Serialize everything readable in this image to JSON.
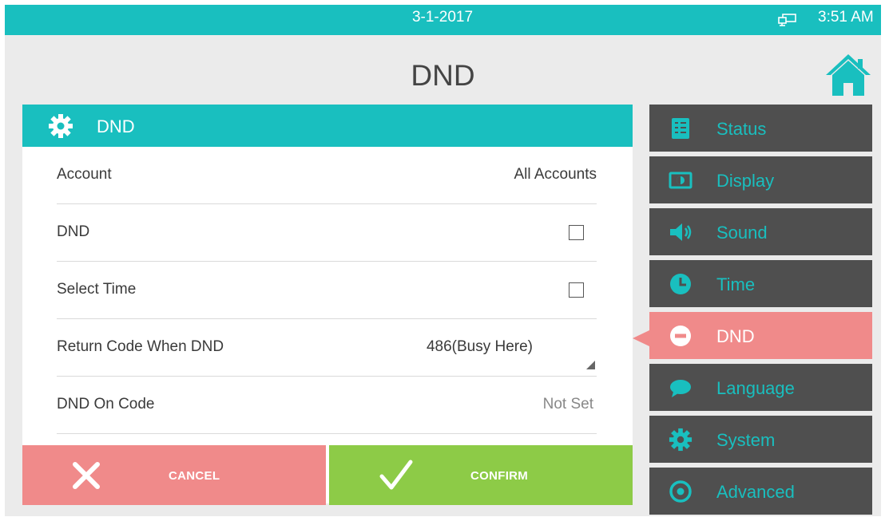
{
  "statusbar": {
    "date": "3-1-2017",
    "time": "3:51 AM",
    "network_icon": "network-icon"
  },
  "page": {
    "title": "DND",
    "home_icon": "home-icon"
  },
  "panel": {
    "header_label": "DND",
    "header_icon": "gear-icon",
    "rows": [
      {
        "label": "Account",
        "value": "All Accounts"
      },
      {
        "label": "DND",
        "checked": false
      },
      {
        "label": "Select Time",
        "checked": false
      },
      {
        "label": "Return Code When DND",
        "value": "486(Busy Here)"
      },
      {
        "label": "DND On Code",
        "value": "Not Set"
      }
    ]
  },
  "buttons": {
    "cancel": "CANCEL",
    "confirm": "CONFIRM"
  },
  "sidebar": {
    "items": [
      {
        "label": "Status",
        "icon": "status-icon"
      },
      {
        "label": "Display",
        "icon": "display-icon"
      },
      {
        "label": "Sound",
        "icon": "speaker-icon"
      },
      {
        "label": "Time",
        "icon": "clock-icon"
      },
      {
        "label": "DND",
        "icon": "dnd-icon",
        "active": true
      },
      {
        "label": "Language",
        "icon": "speech-bubble-icon"
      },
      {
        "label": "System",
        "icon": "gear-icon"
      },
      {
        "label": "Advanced",
        "icon": "target-icon"
      }
    ]
  },
  "colors": {
    "teal": "#19bfbf",
    "red": "#f08a8a",
    "green": "#8dcb47",
    "menu_dark": "#4f4f4f"
  }
}
